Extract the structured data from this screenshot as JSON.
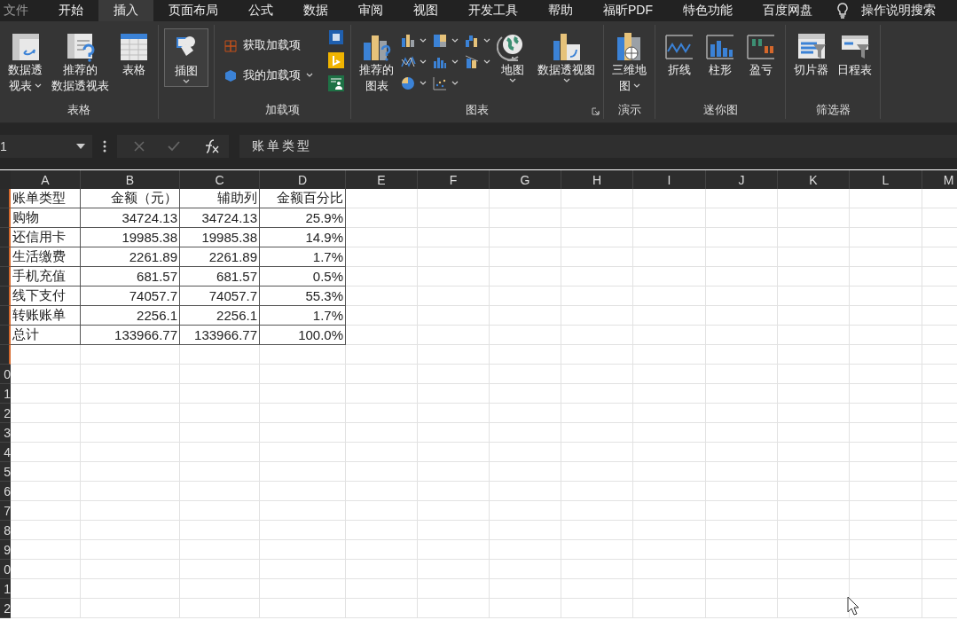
{
  "menu_tabs": [
    {
      "label": "文件",
      "selected": false
    },
    {
      "label": "开始",
      "selected": false
    },
    {
      "label": "插入",
      "selected": true
    },
    {
      "label": "页面布局",
      "selected": false
    },
    {
      "label": "公式",
      "selected": false
    },
    {
      "label": "数据",
      "selected": false
    },
    {
      "label": "审阅",
      "selected": false
    },
    {
      "label": "视图",
      "selected": false
    },
    {
      "label": "开发工具",
      "selected": false
    },
    {
      "label": "帮助",
      "selected": false
    },
    {
      "label": "福昕PDF",
      "selected": false
    },
    {
      "label": "特色功能",
      "selected": false
    },
    {
      "label": "百度网盘",
      "selected": false
    }
  ],
  "search": {
    "label": "操作说明搜索"
  },
  "ribbon": {
    "groups": [
      {
        "label": "表格",
        "items": [
          {
            "kind": "large",
            "label_lines": [
              "数据透",
              "视表"
            ],
            "dropdown": true
          },
          {
            "kind": "large",
            "label_lines": [
              "推荐的",
              "数据透视表"
            ],
            "dropdown": false
          },
          {
            "kind": "large",
            "label_lines": [
              "表格"
            ],
            "dropdown": false
          }
        ]
      },
      {
        "items": [
          {
            "kind": "framed",
            "label_lines": [
              "插图"
            ],
            "dropdown": true
          }
        ]
      },
      {
        "label": "加载项",
        "items": [
          {
            "kind": "small",
            "label": "获取加载项",
            "dropdown": false
          },
          {
            "kind": "small",
            "label": "我的加载项",
            "dropdown": true
          },
          {
            "kind": "icons"
          }
        ]
      },
      {
        "label": "图表",
        "launcher": true,
        "items": [
          {
            "kind": "large",
            "label_lines": [
              "推荐的",
              "图表"
            ],
            "dropdown": false
          },
          {
            "kind": "chartgrid"
          },
          {
            "kind": "large",
            "label_lines": [
              "地图"
            ],
            "dropdown": true
          },
          {
            "kind": "large",
            "label_lines": [
              "数据透视图"
            ],
            "dropdown": true
          }
        ]
      },
      {
        "label": "演示",
        "items": [
          {
            "kind": "large",
            "label_lines": [
              "三维地",
              "图"
            ],
            "dropdown": true
          }
        ]
      },
      {
        "label": "迷你图",
        "items": [
          {
            "kind": "large",
            "label_lines": [
              "折线"
            ],
            "dropdown": false
          },
          {
            "kind": "large",
            "label_lines": [
              "柱形"
            ],
            "dropdown": false
          },
          {
            "kind": "large",
            "label_lines": [
              "盈亏"
            ],
            "dropdown": false
          }
        ]
      },
      {
        "label": "筛选器",
        "items": [
          {
            "kind": "large",
            "label_lines": [
              "切片器"
            ],
            "dropdown": false
          },
          {
            "kind": "large",
            "label_lines": [
              "日程表"
            ],
            "dropdown": false
          }
        ]
      }
    ]
  },
  "formula_bar": {
    "name_box": "1",
    "value": "账单类型"
  },
  "sheet": {
    "columns": [
      "A",
      "B",
      "C",
      "D",
      "E",
      "F",
      "G",
      "H",
      "I",
      "J",
      "K",
      "L",
      "M"
    ],
    "row_headers": [
      {
        "selected": true
      },
      {
        "selected": true
      },
      {
        "selected": true
      },
      {
        "selected": true
      },
      {
        "selected": true
      },
      {
        "selected": true
      },
      {
        "selected": true
      },
      {
        "selected": true
      },
      {
        "selected": true
      },
      {
        "label": "0",
        "selected": false
      },
      {
        "label": "1",
        "selected": false
      },
      {
        "label": "2",
        "selected": false
      },
      {
        "label": "3",
        "selected": false
      },
      {
        "label": "4",
        "selected": false
      },
      {
        "label": "5",
        "selected": false
      },
      {
        "label": "6",
        "selected": false
      },
      {
        "label": "7",
        "selected": false
      },
      {
        "label": "8",
        "selected": false
      },
      {
        "label": "9",
        "selected": false
      },
      {
        "label": "0",
        "selected": false
      },
      {
        "label": "1",
        "selected": false
      },
      {
        "label": "2",
        "selected": false
      }
    ],
    "rows": [
      [
        "账单类型",
        "金额（元）",
        "辅助列",
        "金额百分比"
      ],
      [
        "购物",
        "34724.13",
        "34724.13",
        "25.9%"
      ],
      [
        "还信用卡",
        "19985.38",
        "19985.38",
        "14.9%"
      ],
      [
        "生活缴费",
        "2261.89",
        "2261.89",
        "1.7%"
      ],
      [
        "手机充值",
        "681.57",
        "681.57",
        "0.5%"
      ],
      [
        "线下支付",
        "74057.7",
        "74057.7",
        "55.3%"
      ],
      [
        "转账账单",
        "2256.1",
        "2256.1",
        "1.7%"
      ],
      [
        "总计",
        "133966.77",
        "133966.77",
        "100.0%"
      ]
    ]
  }
}
